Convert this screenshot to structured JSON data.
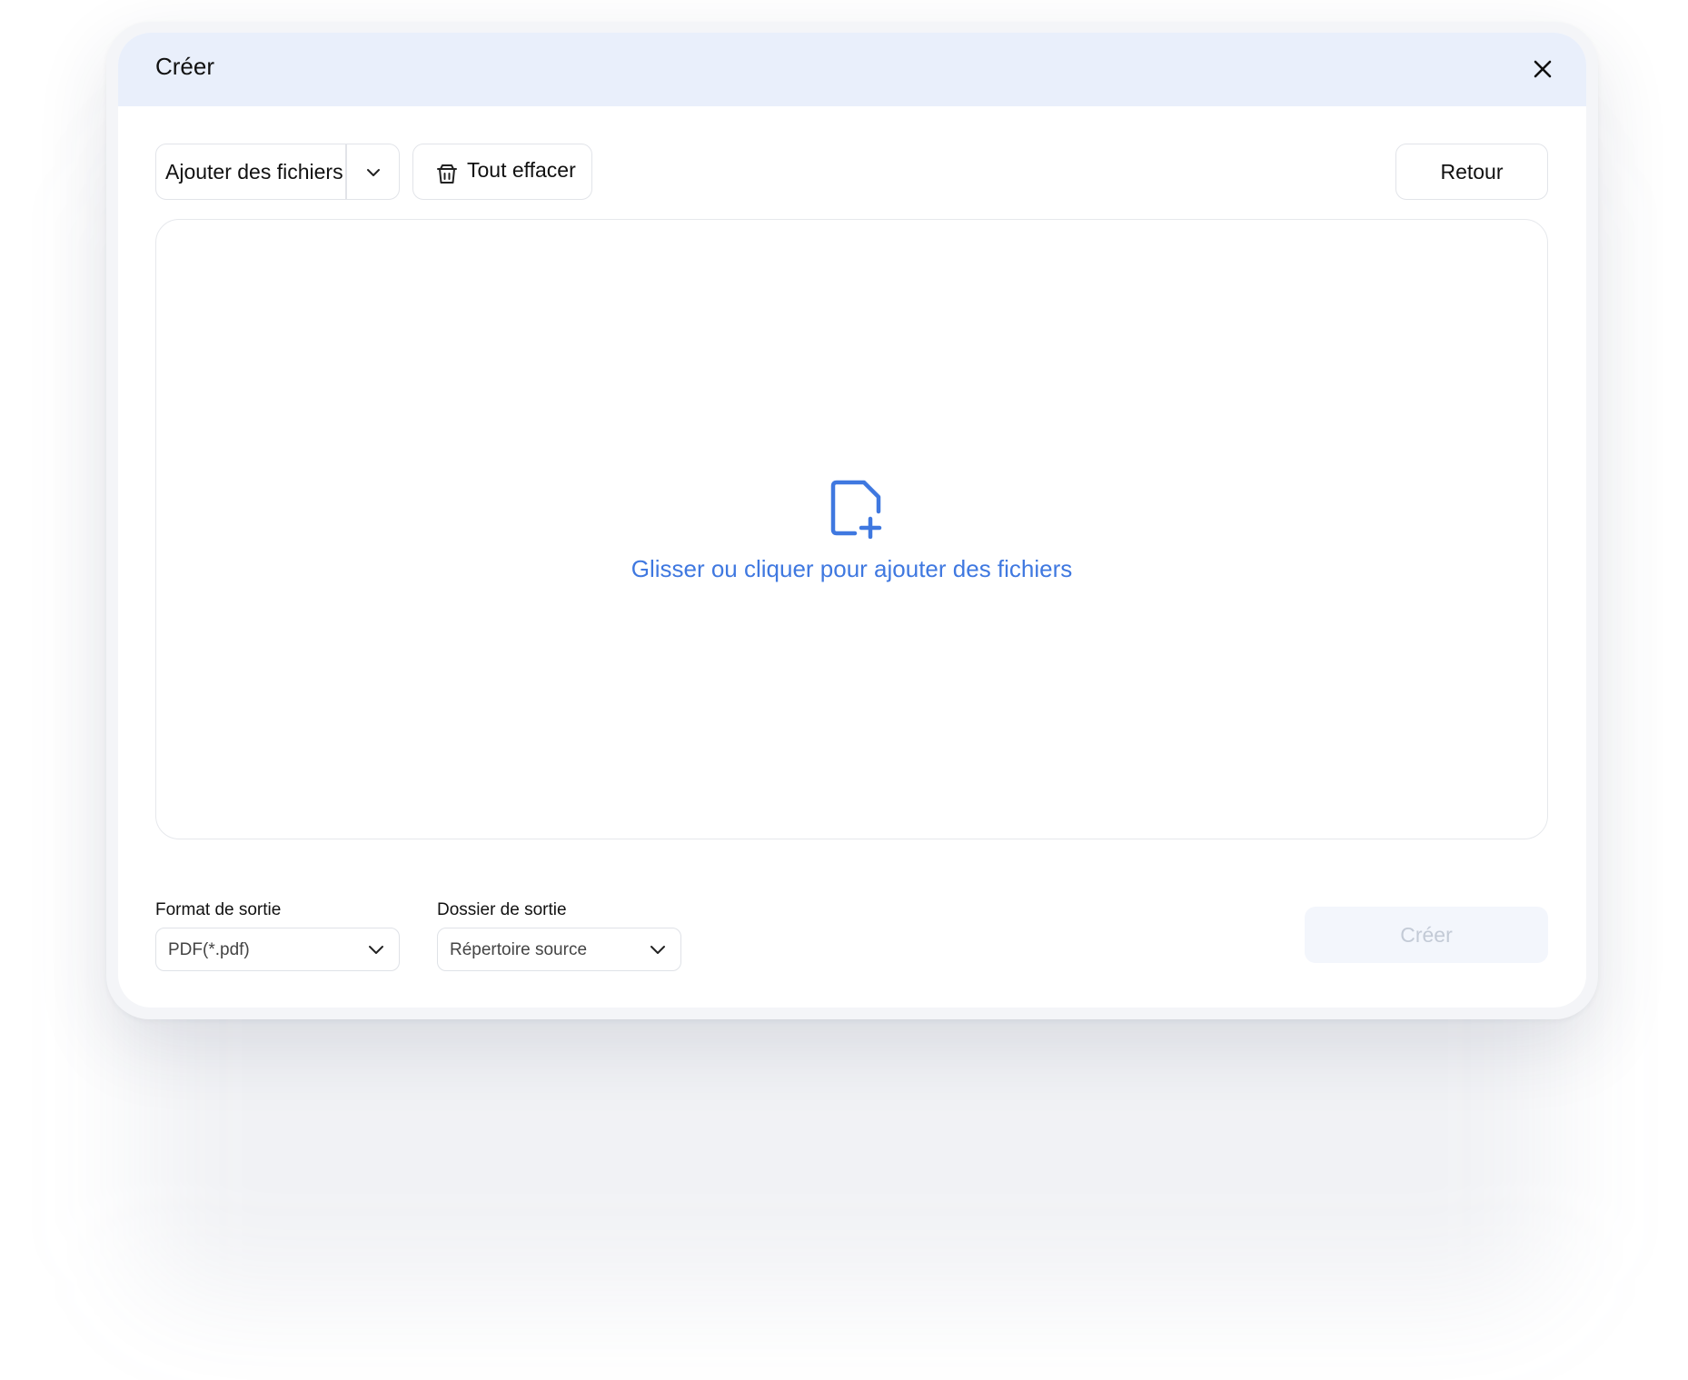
{
  "dialog": {
    "title": "Créer",
    "close_icon": "close-icon"
  },
  "toolbar": {
    "add_files_label": "Ajouter des fichiers",
    "add_files_dropdown_icon": "chevron-down-icon",
    "clear_all_label": "Tout effacer",
    "clear_all_icon": "trash-basket-icon",
    "back_label": "Retour"
  },
  "dropzone": {
    "icon": "file-add-icon",
    "text": "Glisser ou cliquer pour ajouter des fichiers",
    "accent_color": "#3f78e0"
  },
  "output": {
    "format_label": "Format de sortie",
    "format_value": "PDF(*.pdf)",
    "folder_label": "Dossier de sortie",
    "folder_value": "Répertoire source",
    "create_label": "Créer",
    "create_disabled": true
  },
  "colors": {
    "titlebar_bg": "#e9effb",
    "accent": "#3f78e0"
  }
}
